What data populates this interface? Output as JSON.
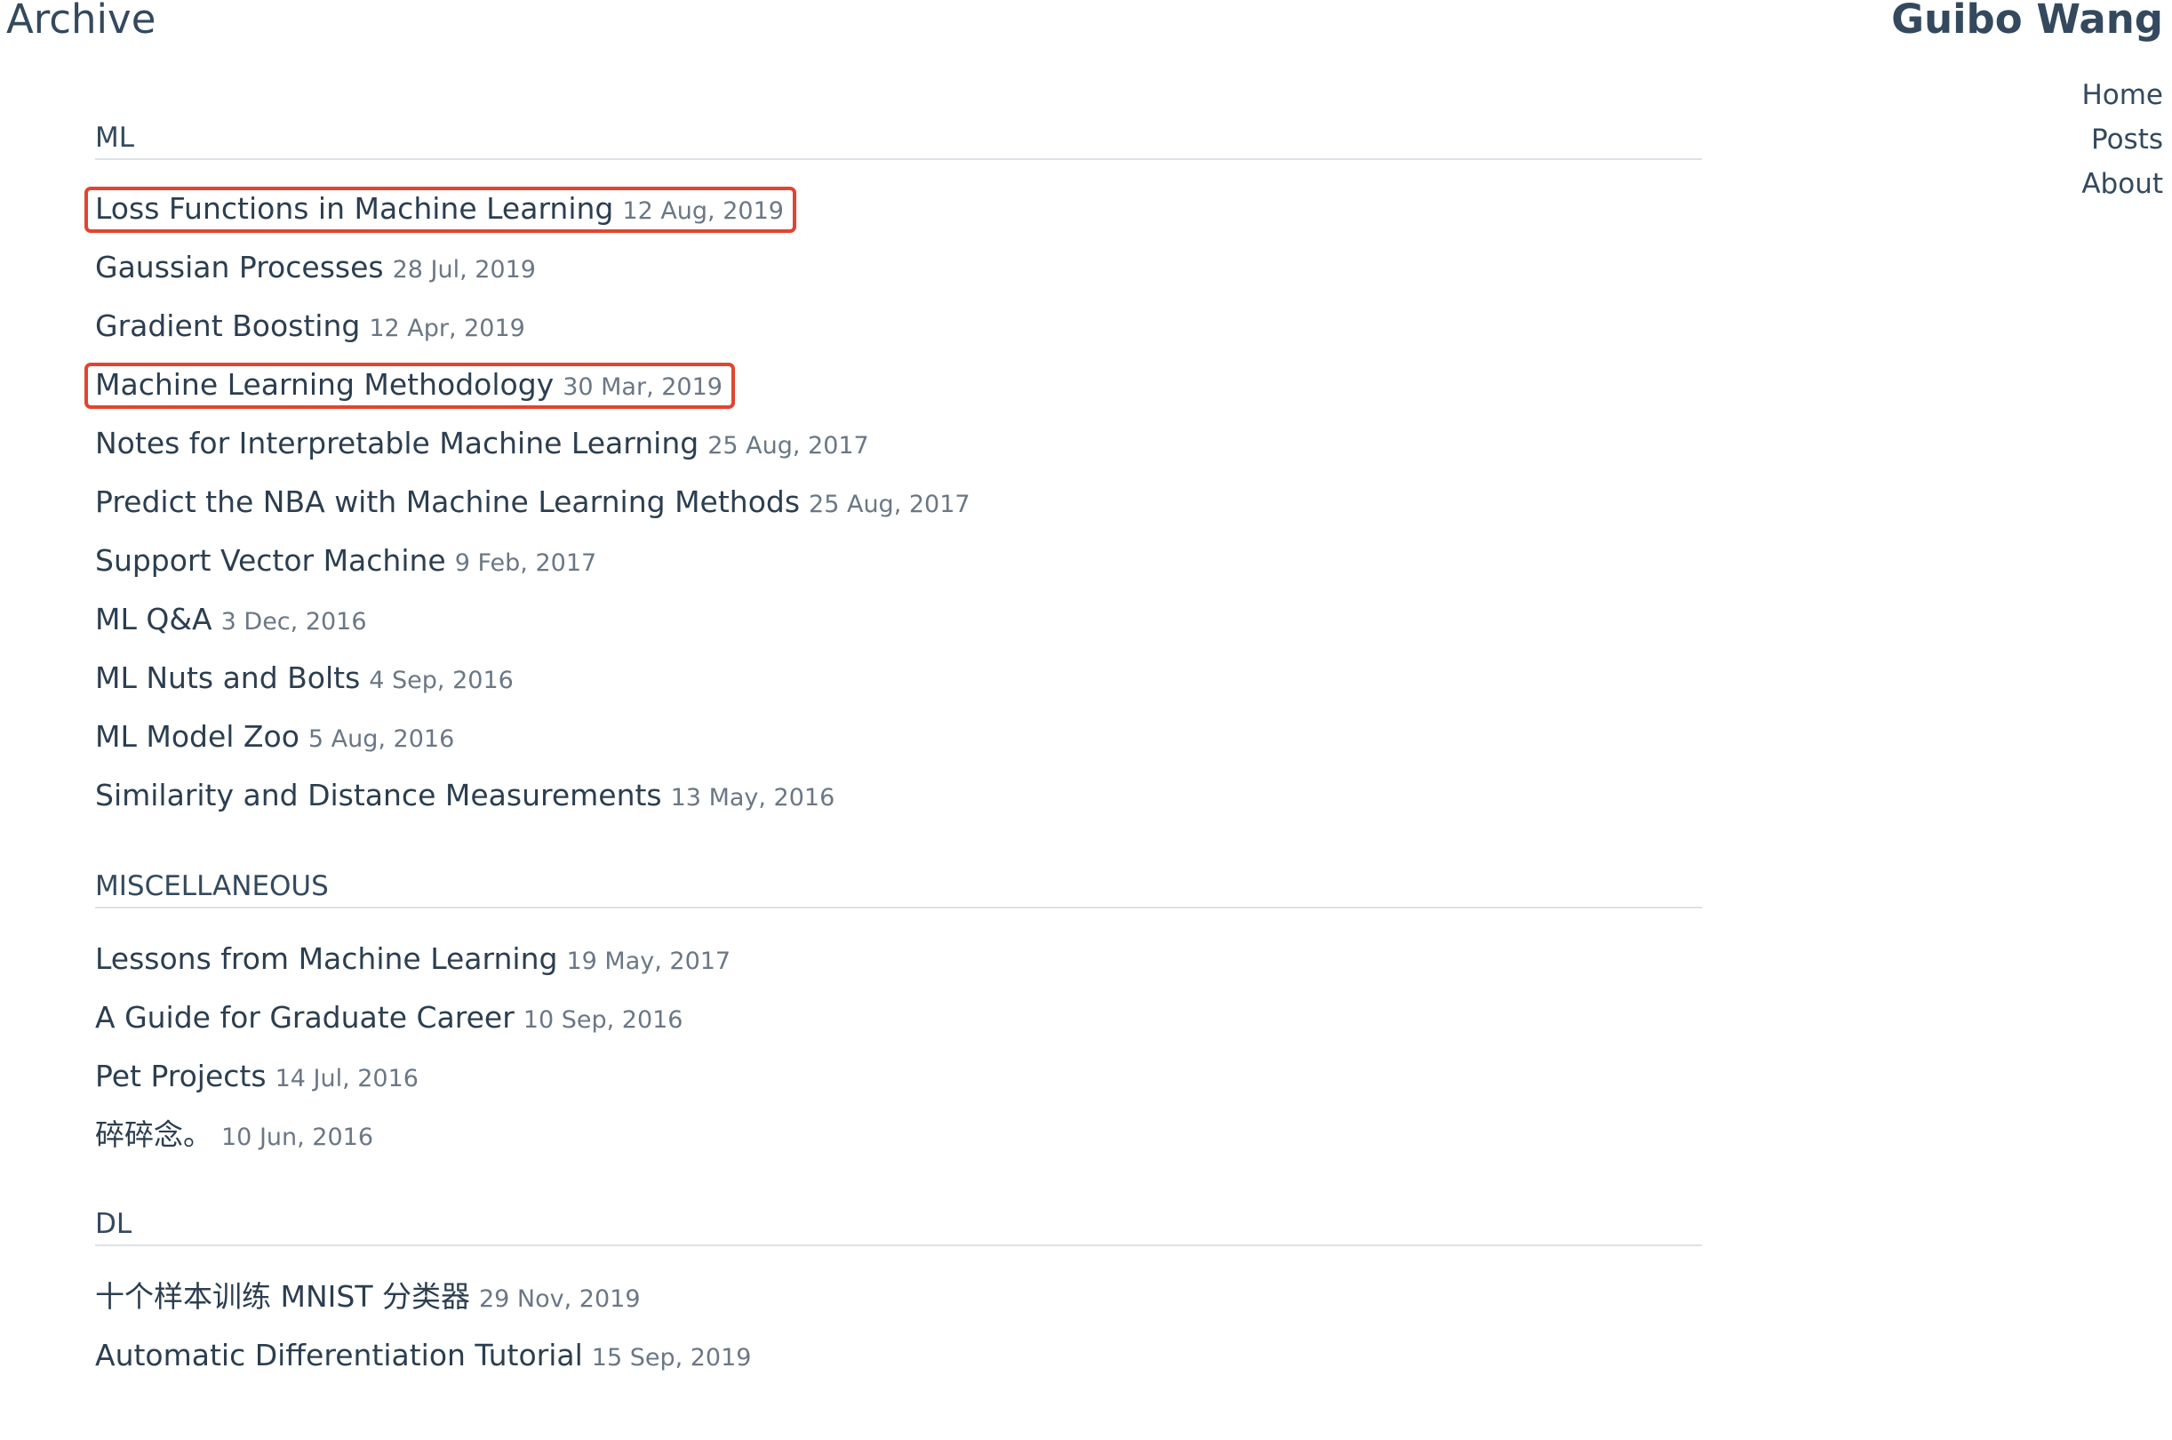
{
  "header": {
    "page_title": "Archive",
    "site_name": "Guibo Wang",
    "nav": [
      "Home",
      "Posts",
      "About"
    ]
  },
  "sections": [
    {
      "title": "ML",
      "posts": [
        {
          "title": "Loss Functions in Machine Learning",
          "date": "12 Aug, 2019",
          "highlighted": true
        },
        {
          "title": "Gaussian Processes",
          "date": "28 Jul, 2019"
        },
        {
          "title": "Gradient Boosting",
          "date": "12 Apr, 2019"
        },
        {
          "title": "Machine Learning Methodology",
          "date": "30 Mar, 2019",
          "highlighted": true
        },
        {
          "title": "Notes for Interpretable Machine Learning",
          "date": "25 Aug, 2017"
        },
        {
          "title": "Predict the NBA with Machine Learning Methods",
          "date": "25 Aug, 2017"
        },
        {
          "title": "Support Vector Machine",
          "date": "9 Feb, 2017"
        },
        {
          "title": "ML Q&A",
          "date": "3 Dec, 2016"
        },
        {
          "title": "ML Nuts and Bolts",
          "date": "4 Sep, 2016"
        },
        {
          "title": "ML Model Zoo",
          "date": "5 Aug, 2016"
        },
        {
          "title": "Similarity and Distance Measurements",
          "date": "13 May, 2016"
        }
      ]
    },
    {
      "title": "MISCELLANEOUS",
      "posts": [
        {
          "title": "Lessons from Machine Learning",
          "date": "19 May, 2017"
        },
        {
          "title": "A Guide for Graduate Career",
          "date": "10 Sep, 2016"
        },
        {
          "title": "Pet Projects",
          "date": "14 Jul, 2016"
        },
        {
          "title": "碎碎念。",
          "date": "10 Jun, 2016"
        }
      ]
    },
    {
      "title": "DL",
      "posts": [
        {
          "title": "十个样本训练 MNIST 分类器",
          "date": "29 Nov, 2019"
        },
        {
          "title": "Automatic Differentiation Tutorial",
          "date": "15 Sep, 2019"
        }
      ]
    }
  ],
  "colors": {
    "text": "#34495e",
    "highlight_border": "#e0452f",
    "divider": "#dde1e6"
  }
}
